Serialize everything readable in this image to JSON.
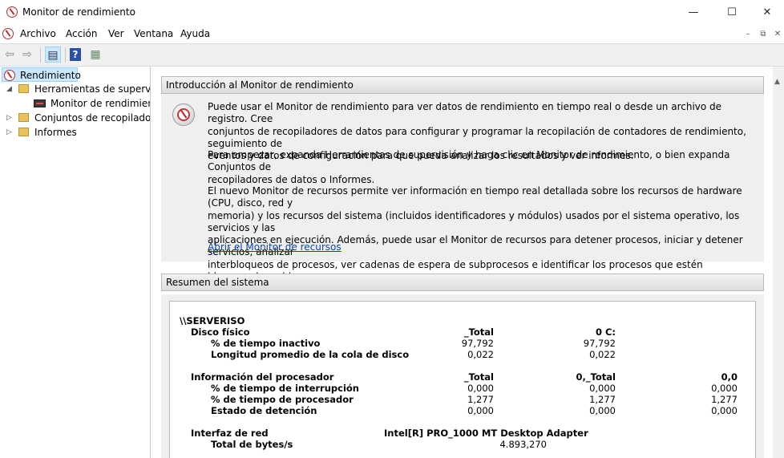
{
  "window": {
    "title": "Monitor de rendimiento",
    "minimize": "—",
    "maximize": "☐",
    "close": "✕"
  },
  "menu": {
    "items": [
      "Archivo",
      "Acción",
      "Ver",
      "Ventana",
      "Ayuda"
    ],
    "mdi": [
      "–",
      "⧉",
      "✕"
    ]
  },
  "toolbar": {
    "back": "⇦",
    "forward": "⇨",
    "console_tree": "▤",
    "help": "?",
    "properties": "▦"
  },
  "tree": {
    "root": "Rendimiento",
    "monitoring_tools": "Herramientas de supervisión",
    "performance_monitor": "Monitor de rendimiento",
    "collector_sets": "Conjuntos de recopiladores de datos",
    "reports": "Informes"
  },
  "intro": {
    "header": "Introducción al Monitor de rendimiento",
    "p1": [
      "Puede usar el Monitor de rendimiento para ver datos de rendimiento en tiempo real o desde un archivo de registro. Cree",
      "conjuntos de recopiladores de datos para configurar y programar la recopilación de contadores de rendimiento, seguimiento de",
      "eventos y datos de configuración para que pueda analizar los resultados y ver informes."
    ],
    "p2": [
      "Para empezar, expanda Herramientas de supervisión y haga clic en Monitor de rendimiento, o bien expanda Conjuntos de",
      "recopiladores de datos o Informes."
    ],
    "p3": [
      "El nuevo Monitor de recursos permite ver información en tiempo real detallada sobre los recursos de hardware (CPU, disco, red y",
      "memoria) y los recursos del sistema (incluidos identificadores y módulos) usados por el sistema operativo, los servicios y las",
      "aplicaciones en ejecución. Además, puede usar el Monitor de recursos para detener procesos, iniciar y detener servicios, analizar",
      "interbloqueos de procesos, ver cadenas de espera de subprocesos e identificar los procesos que estén bloqueando archivos."
    ],
    "link": "Abrir el Monitor de recursos"
  },
  "summary": {
    "header": "Resumen del sistema",
    "server": "\\\\SERVERISO",
    "disk": {
      "title": "Disco físico",
      "cols": [
        "_Total",
        "0 C:"
      ],
      "rows": [
        {
          "label": "% de tiempo inactivo",
          "values": [
            "97,792",
            "97,792"
          ]
        },
        {
          "label": "Longitud promedio de la cola de disco",
          "values": [
            "0,022",
            "0,022"
          ]
        }
      ]
    },
    "cpu": {
      "title": "Información del procesador",
      "cols": [
        "_Total",
        "0,_Total",
        "0,0"
      ],
      "rows": [
        {
          "label": "% de tiempo de interrupción",
          "values": [
            "0,000",
            "0,000",
            "0,000"
          ]
        },
        {
          "label": "% de tiempo de procesador",
          "values": [
            "1,277",
            "1,277",
            "1,277"
          ]
        },
        {
          "label": "Estado de detención",
          "values": [
            "0,000",
            "0,000",
            "0,000"
          ]
        }
      ]
    },
    "net": {
      "title": "Interfaz de red",
      "col": "Intel[R] PRO_1000 MT Desktop Adapter",
      "rows": [
        {
          "label": "Total de bytes/s",
          "value": "4.893,270"
        }
      ]
    }
  }
}
